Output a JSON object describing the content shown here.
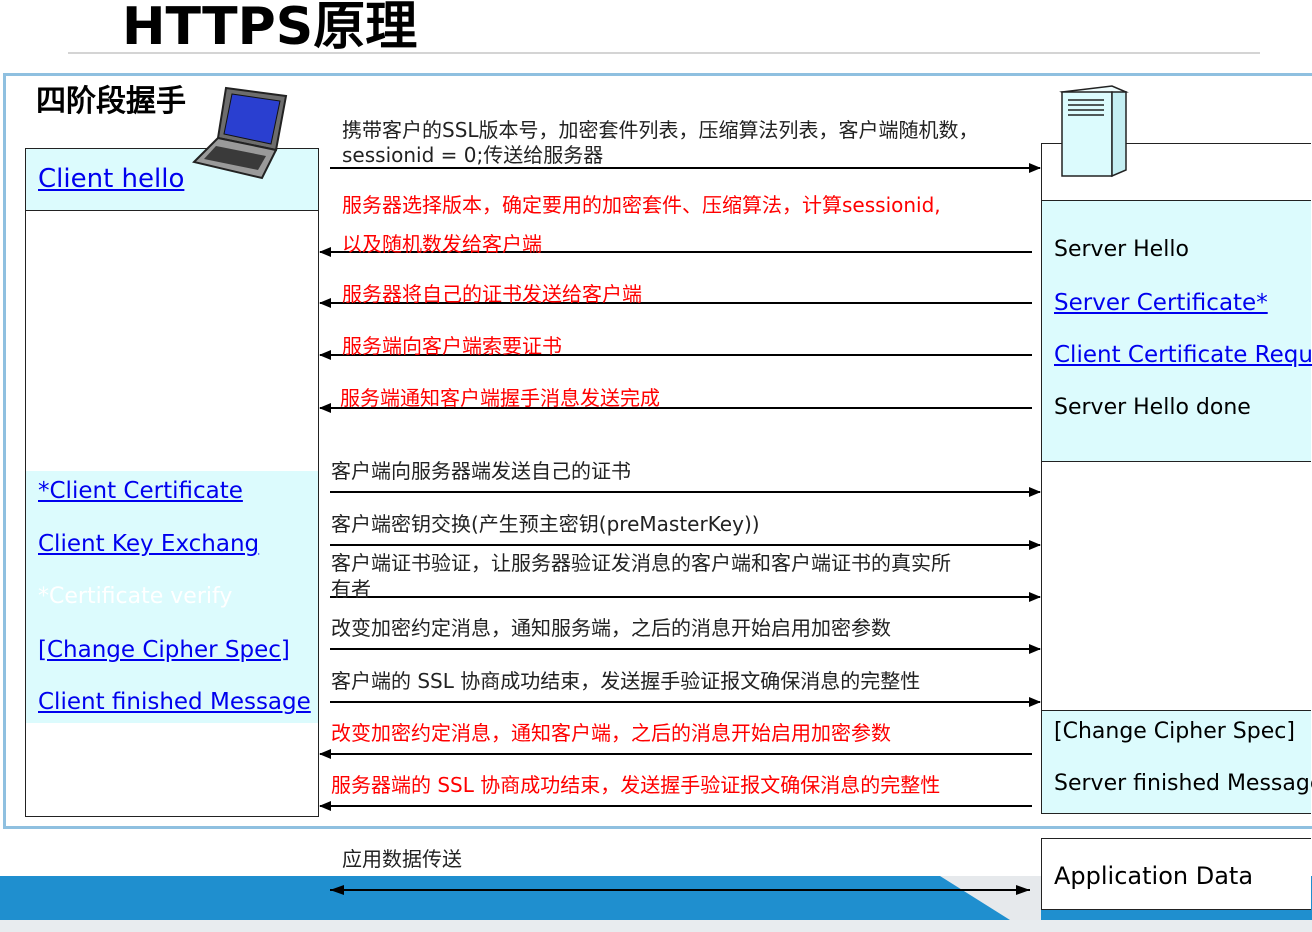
{
  "title": "HTTPS原理",
  "stage_title": "四阶段握手",
  "client_hello": "Client hello",
  "client_msgs": {
    "cert": "*Client Certificate",
    "key": "Client Key Exchang",
    "verify": "*Certificate verify",
    "cipher": "[Change Cipher Spec]",
    "finished": "Client finished Message"
  },
  "server_msgs": {
    "hello": "Server Hello",
    "cert": "Server Certificate*",
    "cert_req": "Client Certificate Requst*",
    "done": "Server Hello done",
    "cipher": "[Change Cipher Spec]",
    "finished": "Server finished Message"
  },
  "messages": {
    "m1a": "携带客户的SSL版本号，加密套件列表，压缩算法列表，客户端随机数，",
    "m1b": "sessionid = 0;传送给服务器",
    "m2a": "服务器选择版本，确定要用的加密套件、压缩算法，计算sessionid,",
    "m2b": "以及随机数发给客户端",
    "m3": "服务器将自己的证书发送给客户端",
    "m4": "服务端向客户端索要证书",
    "m5": "服务端通知客户端握手消息发送完成",
    "m6": "客户端向服务器端发送自己的证书",
    "m7": "客户端密钥交换(产生预主密钥(preMasterKey))",
    "m8a": "客户端证书验证，让服务器验证发消息的客户端和客户端证书的真实所",
    "m8b": "有者",
    "m9": "改变加密约定消息，通知服务端，之后的消息开始启用加密参数",
    "m10": "客户端的 SSL 协商成功结束，发送握手验证报文确保消息的完整性",
    "m11": "改变加密约定消息，通知客户端，之后的消息开始启用加密参数",
    "m12": "服务器端的 SSL 协商成功结束，发送握手验证报文确保消息的完整性",
    "app_label": "应用数据传送"
  },
  "application_data": "Application Data",
  "colors": {
    "accent": "#1f8fcf",
    "cyan_box": "#dcfbfd",
    "red_text": "#ff0000",
    "link": "#0000ee"
  }
}
